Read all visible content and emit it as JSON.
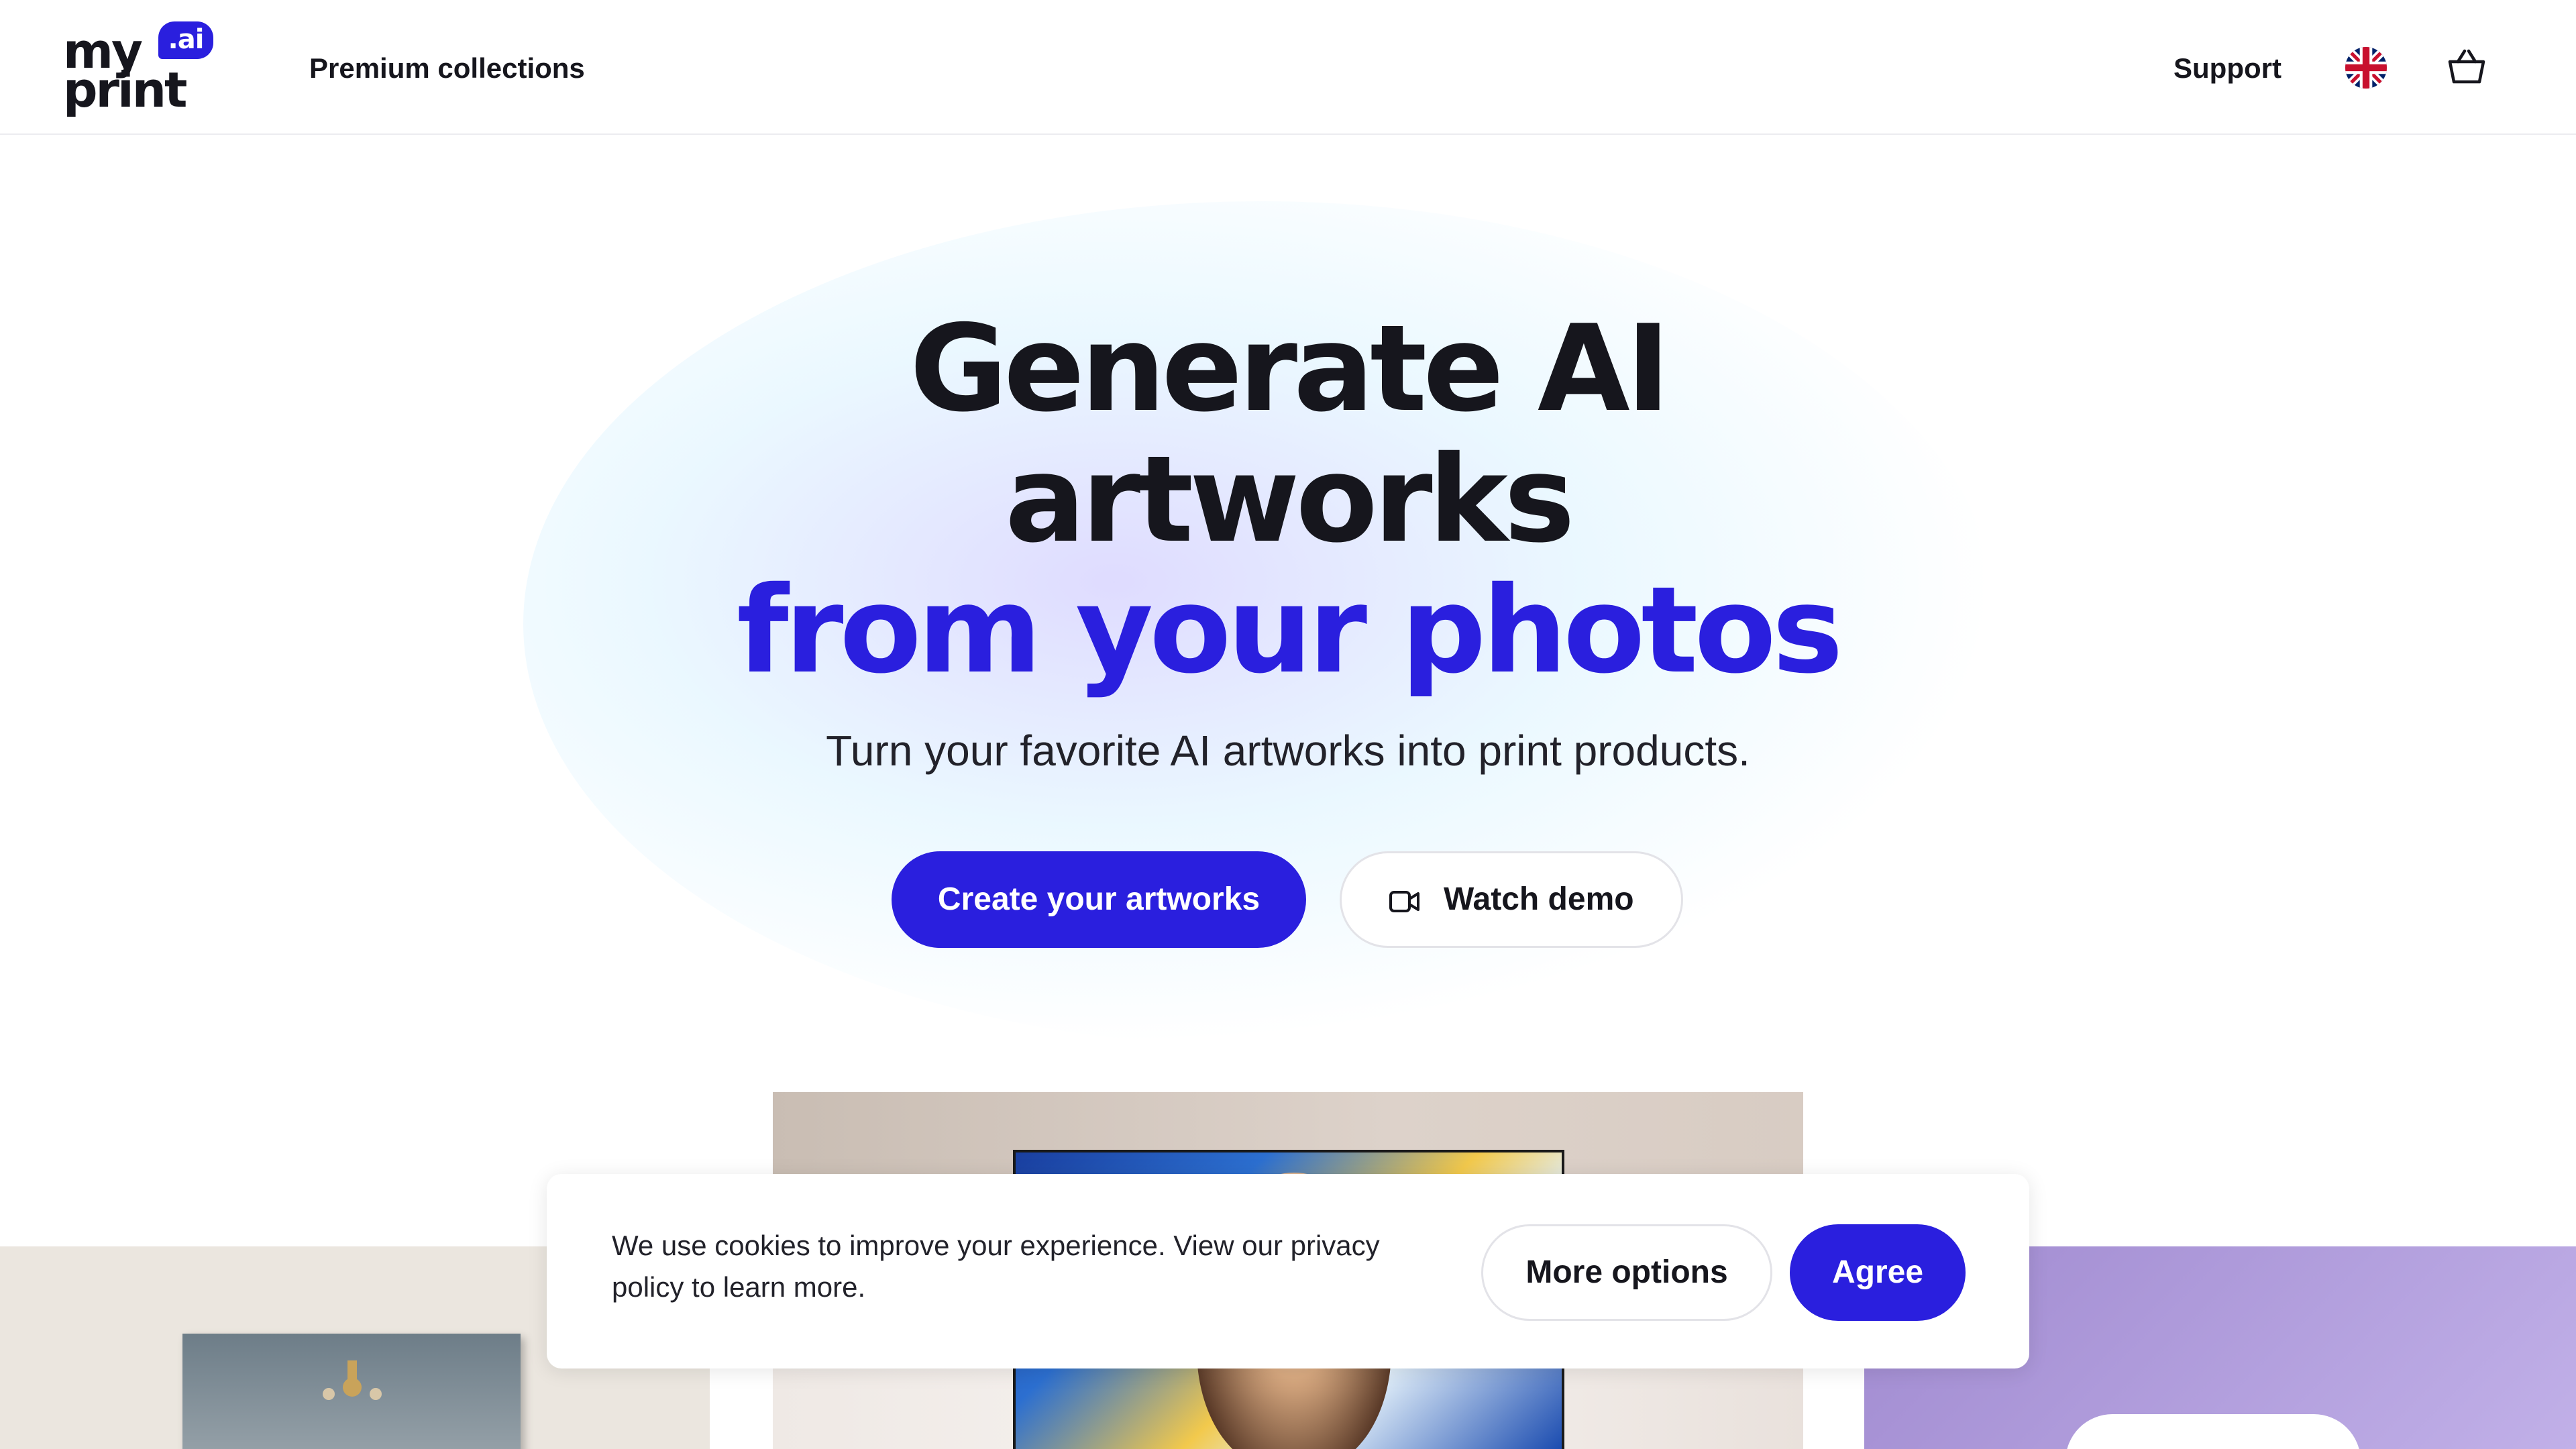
{
  "brand": {
    "logo_line1": "my",
    "logo_line2": "print",
    "logo_badge": ".ai",
    "accent_color": "#2a1fde"
  },
  "header": {
    "nav": {
      "premium_collections": "Premium collections",
      "support": "Support"
    },
    "language_icon": "uk-flag-icon",
    "cart_icon": "shopping-basket-icon"
  },
  "hero": {
    "title_line1": "Generate AI",
    "title_line2": "artworks",
    "title_line3": "from your photos",
    "subtitle": "Turn your favorite AI artworks into print products.",
    "primary_button": "Create your artworks",
    "secondary_button": "Watch demo",
    "secondary_button_icon": "video-camera-icon"
  },
  "cookie_banner": {
    "text": "We use cookies to improve your experience. View our privacy policy to learn more.",
    "more_options": "More options",
    "agree": "Agree"
  }
}
